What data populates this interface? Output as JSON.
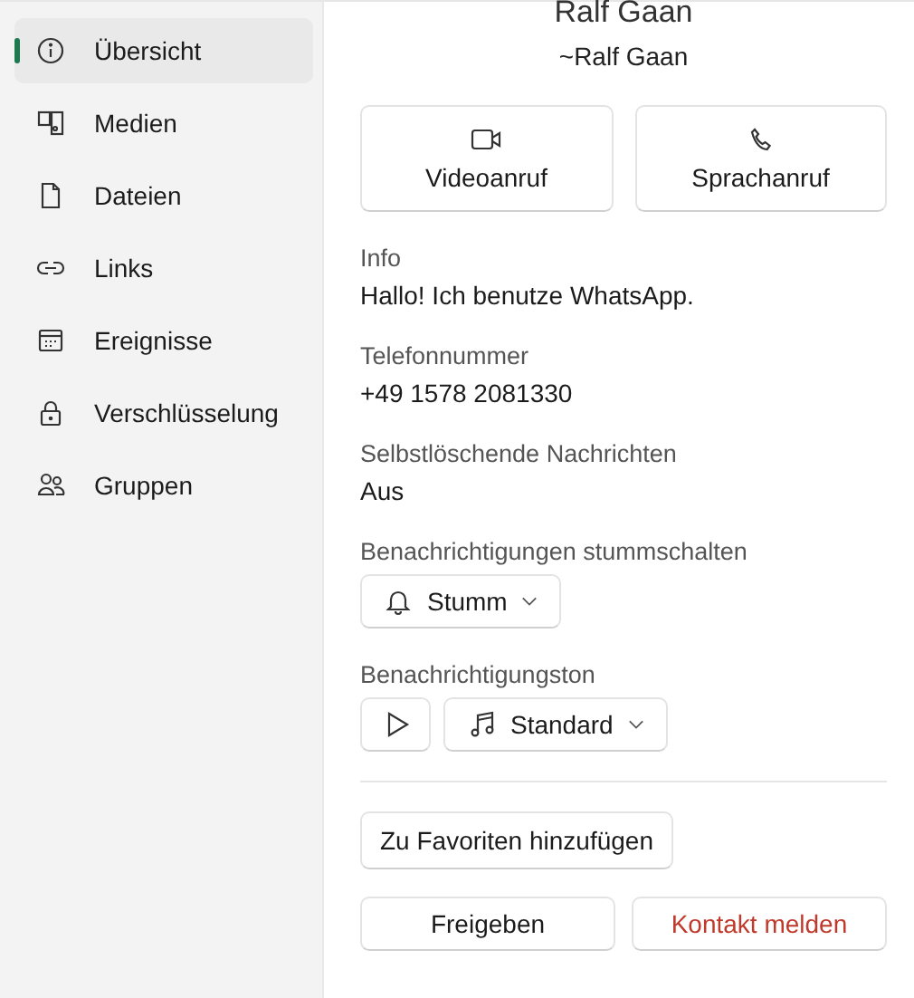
{
  "sidebar": {
    "items": [
      {
        "label": "Übersicht",
        "kind": "info",
        "selected": true
      },
      {
        "label": "Medien",
        "kind": "media",
        "selected": false
      },
      {
        "label": "Dateien",
        "kind": "file",
        "selected": false
      },
      {
        "label": "Links",
        "kind": "link",
        "selected": false
      },
      {
        "label": "Ereignisse",
        "kind": "calendar",
        "selected": false
      },
      {
        "label": "Verschlüsselung",
        "kind": "lock",
        "selected": false
      },
      {
        "label": "Gruppen",
        "kind": "people",
        "selected": false
      }
    ]
  },
  "profile": {
    "name": "Ralf Gaan",
    "push_name": "~Ralf Gaan"
  },
  "call_buttons": [
    {
      "label": "Videoanruf",
      "kind": "video"
    },
    {
      "label": "Sprachanruf",
      "kind": "voice"
    }
  ],
  "fields": [
    {
      "label": "Info",
      "value": "Hallo! Ich benutze WhatsApp."
    },
    {
      "label": "Telefonnummer",
      "value": "+49 1578 2081330"
    },
    {
      "label": "Selbstlöschende Nachrichten",
      "value": "Aus"
    }
  ],
  "mute": {
    "label": "Benachrichtigungen stummschalten",
    "value": "Stumm"
  },
  "tone": {
    "label": "Benachrichtigungston",
    "value": "Standard"
  },
  "favorite_button": "Zu Favoriten hinzufügen",
  "actions": [
    {
      "label": "Freigeben",
      "kind": "normal"
    },
    {
      "label": "Kontakt melden",
      "kind": "danger"
    }
  ]
}
